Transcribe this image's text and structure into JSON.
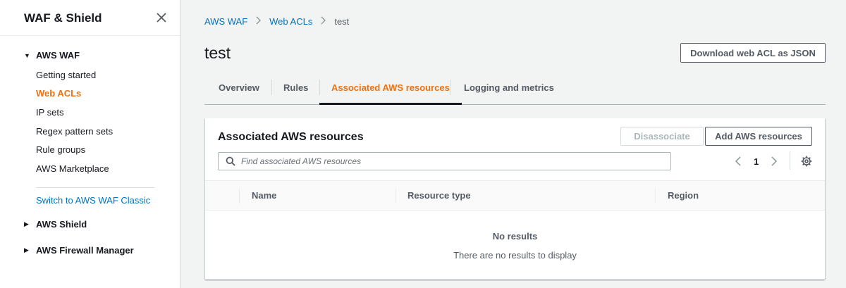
{
  "sidebar": {
    "title": "WAF & Shield",
    "waf_section": "AWS WAF",
    "waf_items": [
      "Getting started",
      "Web ACLs",
      "IP sets",
      "Regex pattern sets",
      "Rule groups",
      "AWS Marketplace"
    ],
    "active_item": "Web ACLs",
    "switch_link": "Switch to AWS WAF Classic",
    "shield_section": "AWS Shield",
    "firewall_section": "AWS Firewall Manager"
  },
  "breadcrumb": {
    "items": [
      "AWS WAF",
      "Web ACLs"
    ],
    "current": "test"
  },
  "page": {
    "title": "test",
    "download_label": "Download web ACL as JSON"
  },
  "tabs": [
    {
      "label": "Overview"
    },
    {
      "label": "Rules"
    },
    {
      "label": "Associated AWS resources"
    },
    {
      "label": "Logging and metrics"
    }
  ],
  "active_tab": "Associated AWS resources",
  "panel": {
    "title": "Associated AWS resources",
    "disassociate_label": "Disassociate",
    "add_label": "Add AWS resources",
    "search_placeholder": "Find associated AWS resources",
    "page_number": "1",
    "columns": [
      "Name",
      "Resource type",
      "Region"
    ],
    "empty_title": "No results",
    "empty_message": "There are no results to display"
  },
  "colors": {
    "accent": "#ec7211",
    "link": "#0073bb"
  }
}
